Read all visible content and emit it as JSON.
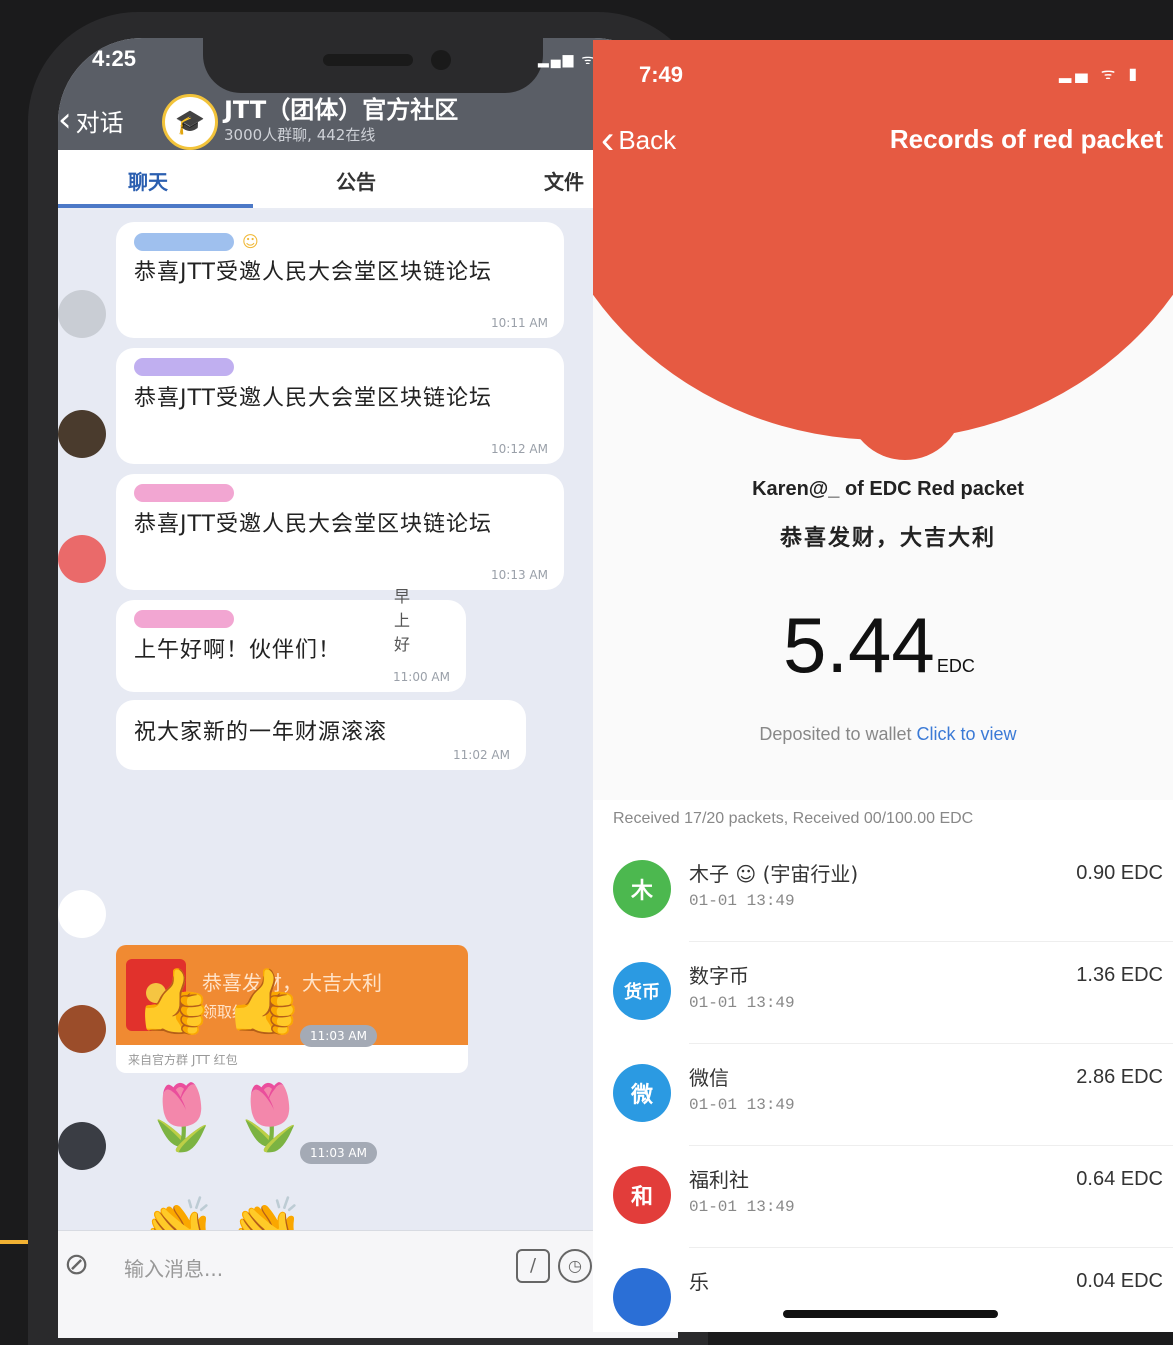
{
  "left_phone": {
    "status_time": "4:25",
    "back_label": "对话",
    "group_title": "JTT（团体）官方社区",
    "group_subtitle": "3000人群聊, 442在线",
    "tabs": [
      "聊天",
      "公告",
      "文件"
    ],
    "messages": [
      {
        "text": "恭喜JTT受邀人民大会堂区块链论坛",
        "time": "10:11 AM"
      },
      {
        "text": "恭喜JTT受邀人民大会堂区块链论坛",
        "time": "10:12 AM"
      },
      {
        "text": "恭喜JTT受邀人民大会堂区块链论坛",
        "time": "10:13 AM"
      },
      {
        "text": "上午好啊！伙伴们！",
        "time": "11:00 AM",
        "extra": "早上好"
      },
      {
        "text": "祝大家新的一年财源滚滚",
        "time": "11:02 AM"
      }
    ],
    "red_packet": {
      "title": "恭喜发财，大吉大利",
      "subtitle": "领取红包",
      "footer": "来自官方群 JTT 红包"
    },
    "emoji_rows": [
      {
        "glyphs": [
          "👍",
          "👍"
        ],
        "time": "11:03 AM"
      },
      {
        "glyphs": [
          "🌷",
          "🌷"
        ],
        "time": "11:03 AM"
      },
      {
        "glyphs": [
          "👏",
          "👏"
        ],
        "time": ""
      }
    ],
    "input_placeholder": "输入消息..."
  },
  "right_phone": {
    "status_time": "7:49",
    "back_label": "Back",
    "title": "Records of red packet",
    "sender_line": "Karen@_ of EDC Red packet",
    "blessing": "恭喜发财，大吉大利",
    "amount": "5.44",
    "amount_unit": "EDC",
    "deposit_text": "Deposited to wallet",
    "deposit_link": "Click to view",
    "summary": "Received 17/20 packets, Received 00/100.00 EDC",
    "records": [
      {
        "icon_char": "木",
        "icon_color": "#4cb84f",
        "name": "木子 ☺ (宇宙行业)",
        "date": "01-01 13:49",
        "amount": "0.90 EDC"
      },
      {
        "icon_char": "货币",
        "icon_color": "#2b9ae2",
        "name": "数字币",
        "date": "01-01 13:49",
        "amount": "1.36 EDC"
      },
      {
        "icon_char": "微",
        "icon_color": "#2b9ae2",
        "name": "微信",
        "date": "01-01 13:49",
        "amount": "2.86 EDC"
      },
      {
        "icon_char": "和",
        "icon_color": "#e23d3a",
        "name": "福利社",
        "date": "01-01 13:49",
        "amount": "0.64 EDC"
      }
    ],
    "partial_record": {
      "name": "乐",
      "amount": "0.04 EDC"
    }
  }
}
